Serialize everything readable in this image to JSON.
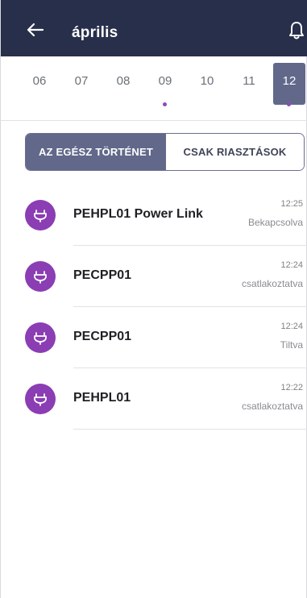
{
  "header": {
    "title": "április",
    "back_icon": "arrow-left-icon",
    "bell_icon": "bell-icon",
    "background": "#272f4a"
  },
  "days": [
    {
      "label": "06",
      "selected": false,
      "has_event": false
    },
    {
      "label": "07",
      "selected": false,
      "has_event": false
    },
    {
      "label": "08",
      "selected": false,
      "has_event": false
    },
    {
      "label": "09",
      "selected": false,
      "has_event": true
    },
    {
      "label": "10",
      "selected": false,
      "has_event": false
    },
    {
      "label": "11",
      "selected": false,
      "has_event": false
    },
    {
      "label": "12",
      "selected": true,
      "has_event": true
    }
  ],
  "filter": {
    "all_label": "AZ EGÉSZ TÖRTÉNET",
    "alarms_label": "CSAK RIASZTÁSOK",
    "active": "all"
  },
  "events": [
    {
      "name": "PEHPL01 Power Link",
      "time": "12:25",
      "status": "Bekapcsolva",
      "icon": "plug-icon"
    },
    {
      "name": "PECPP01",
      "time": "12:24",
      "status": "csatlakoztatva",
      "icon": "plug-icon"
    },
    {
      "name": "PECPP01",
      "time": "12:24",
      "status": "Tiltva",
      "icon": "plug-icon"
    },
    {
      "name": "PEHPL01",
      "time": "12:22",
      "status": "csatlakoztatva",
      "icon": "plug-icon"
    }
  ],
  "colors": {
    "accent": "#61688a",
    "event_icon": "#8b3db4",
    "dot": "#8e49b6"
  }
}
